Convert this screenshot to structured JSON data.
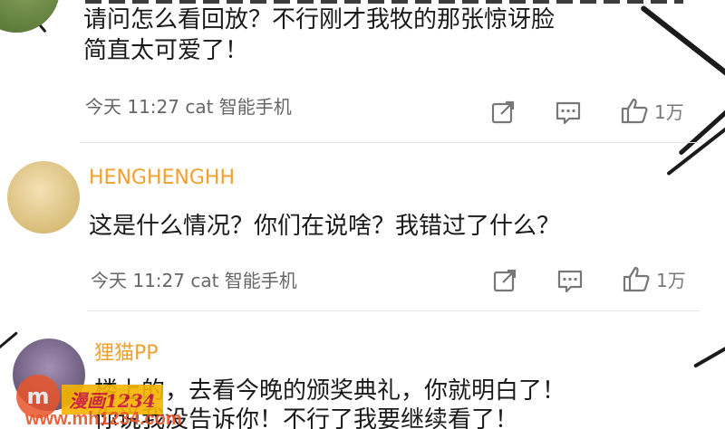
{
  "comments": [
    {
      "username": "",
      "lines": [
        "请问怎么看回放？不行刚才我牧的那张惊讶脸",
        "简直太可爱了！"
      ],
      "meta": "今天 11:27 cat 智能手机",
      "like_count": "1万"
    },
    {
      "username": "HENGHENGHH",
      "lines": [
        "这是什么情况？你们在说啥？我错过了什么？"
      ],
      "meta": "今天 11:27 cat 智能手机",
      "like_count": "1万"
    },
    {
      "username": "狸猫PP",
      "lines": [
        "楼上的，去看今晚的颁奖典礼，你就明白了！",
        "你说我没告诉你！不行了我要继续看了！"
      ],
      "meta": "",
      "like_count": ""
    }
  ],
  "colors": {
    "username_orange": "#f0a030",
    "meta_gray": "#666666",
    "icon_gray": "#777777"
  },
  "icons": [
    "share-icon",
    "comment-icon",
    "like-icon"
  ],
  "watermark": {
    "name": "漫画1234",
    "url": "www.mh1234.com"
  }
}
